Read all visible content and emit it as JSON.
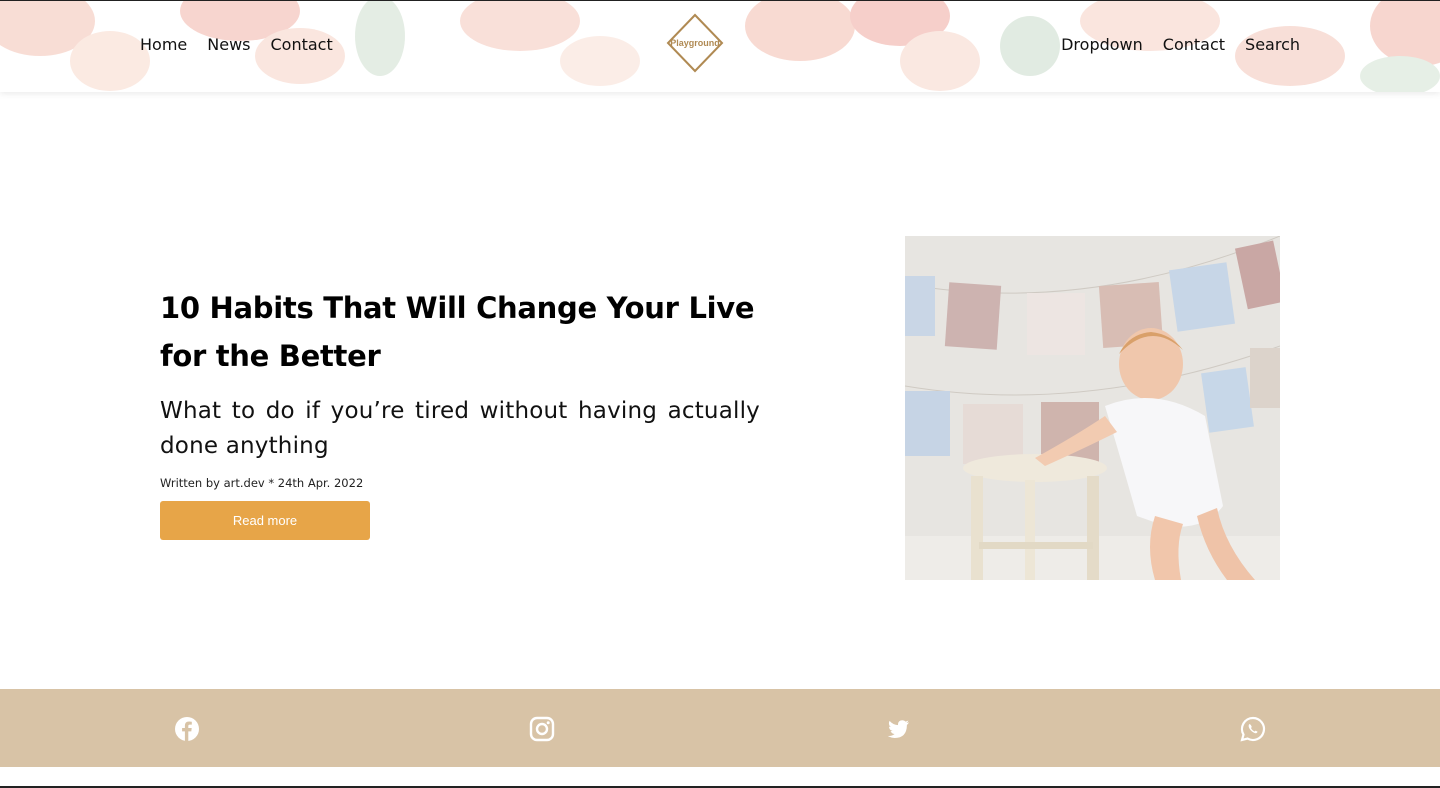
{
  "nav": {
    "left": [
      "Home",
      "News",
      "Contact"
    ],
    "right": [
      "Dropdown",
      "Contact",
      "Search"
    ]
  },
  "logo": {
    "text": "Playground",
    "color": "#b08a53"
  },
  "article": {
    "title": "10 Habits That Will Change Your Live for the Better",
    "subtitle": "What to do if you’re tired without having actually done anything",
    "byline": "Written by art.dev * 24th Apr. 2022",
    "read_more_label": "Read more",
    "image_icon": "baby-standing-at-stool-photo"
  },
  "footer": {
    "background": "#d8c3a6",
    "icons": [
      "facebook-icon",
      "instagram-icon",
      "twitter-icon",
      "whatsapp-icon"
    ]
  },
  "colors": {
    "accent": "#e7a548"
  }
}
